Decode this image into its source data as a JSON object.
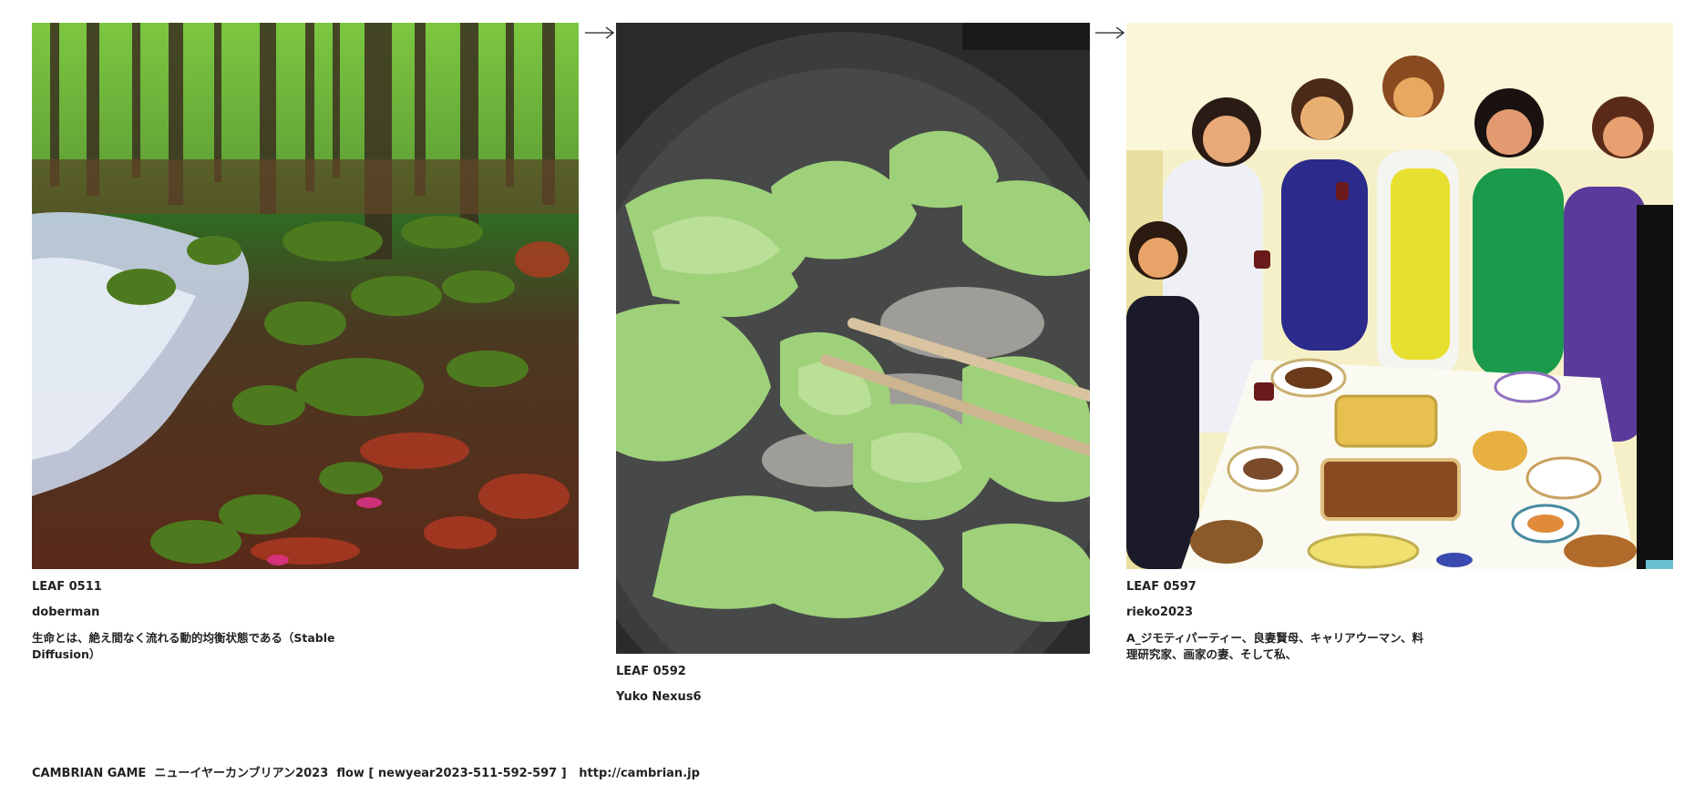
{
  "leaves": [
    {
      "id": "LEAF 0511",
      "author": "doberman",
      "caption": "生命とは、絶え間なく流れる動的均衡状態である（Stable Diffusion）"
    },
    {
      "id": "LEAF 0592",
      "author": "Yuko Nexus6",
      "caption": ""
    },
    {
      "id": "LEAF 0597",
      "author": "rieko2023",
      "caption": "A_ジモティパーティー、良妻賢母、キャリアウーマン、料理研究家、画家の妻、そして私、"
    }
  ],
  "arrows": [
    {
      "icon": "right-arrow-icon"
    },
    {
      "icon": "right-arrow-icon"
    }
  ],
  "footer": {
    "game": "CAMBRIAN GAME",
    "title": "ニューイヤーカンブリアン2023",
    "flow": "flow [ newyear2023-511-592-597 ]",
    "url": "http://cambrian.jp"
  }
}
